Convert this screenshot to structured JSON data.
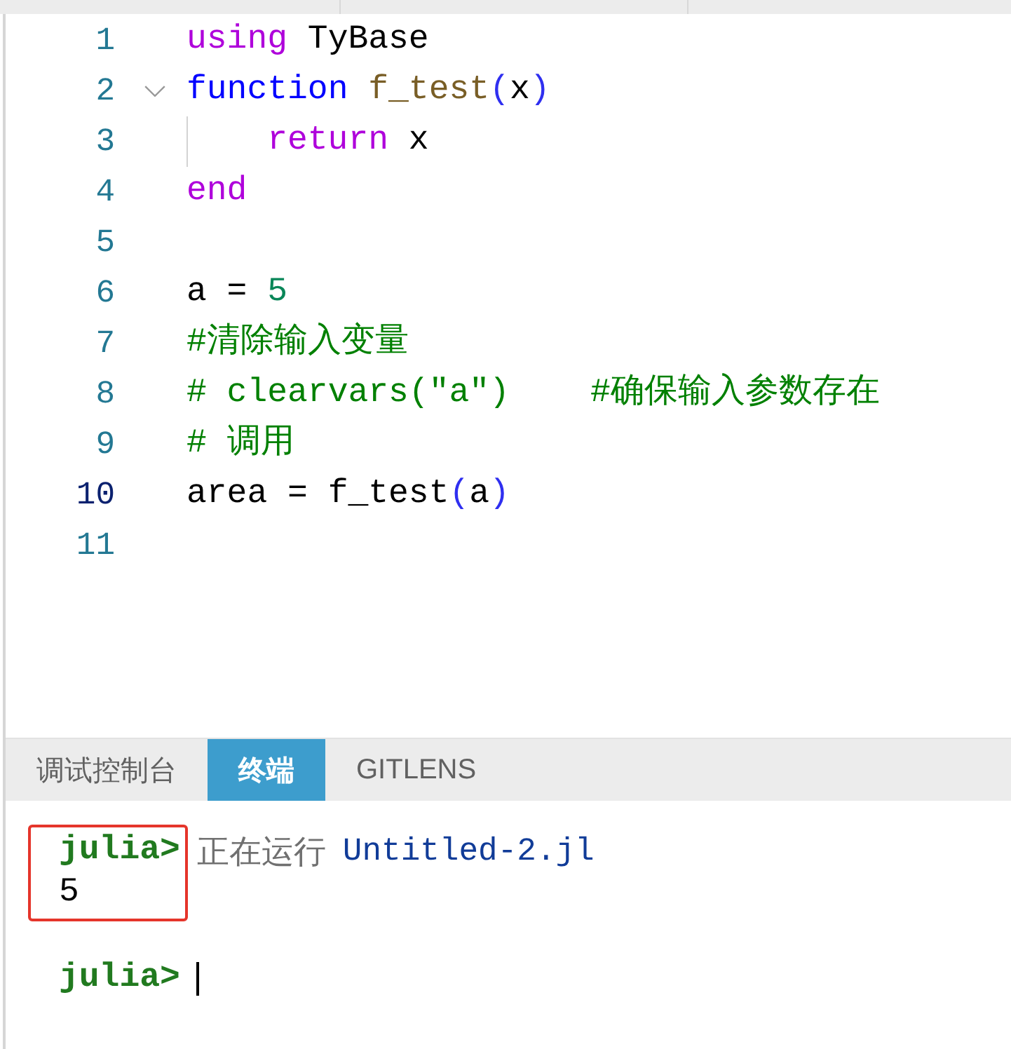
{
  "editor": {
    "lines": [
      {
        "number": "1",
        "active": false,
        "tokens": [
          {
            "kind": "keyword",
            "text": "using"
          },
          {
            "kind": "plain",
            "text": " TyBase"
          }
        ]
      },
      {
        "number": "2",
        "active": false,
        "expanded": true,
        "tokens": [
          {
            "kind": "storage",
            "text": "function"
          },
          {
            "kind": "funcname",
            "text": " f_test"
          },
          {
            "kind": "bracket",
            "text": "("
          },
          {
            "kind": "plain",
            "text": "x"
          },
          {
            "kind": "bracket",
            "text": ")"
          }
        ],
        "children": [
          {
            "number": "3",
            "active": false,
            "tokens": [
              {
                "kind": "keyword",
                "text": "return"
              },
              {
                "kind": "plain",
                "text": " x"
              }
            ]
          }
        ]
      },
      {
        "number": "4",
        "active": false,
        "tokens": [
          {
            "kind": "keyword",
            "text": "end"
          }
        ]
      },
      {
        "number": "5",
        "active": false
      },
      {
        "number": "6",
        "active": false,
        "tokens": [
          {
            "kind": "plain",
            "text": "a = "
          },
          {
            "kind": "number",
            "text": "5"
          }
        ]
      },
      {
        "number": "7",
        "active": false,
        "tokens": [
          {
            "kind": "comment",
            "text": "#清除输入变量"
          }
        ]
      },
      {
        "number": "8",
        "active": false,
        "tokens": [
          {
            "kind": "comment",
            "text": "# clearvars(\"a\")    #确保输入参数存在"
          }
        ]
      },
      {
        "number": "9",
        "active": false,
        "tokens": [
          {
            "kind": "comment",
            "text": "# 调用"
          }
        ]
      },
      {
        "number": "10",
        "active": true,
        "tokens": [
          {
            "kind": "plain",
            "text": "area = f_test"
          },
          {
            "kind": "bracket",
            "text": "("
          },
          {
            "kind": "plain",
            "text": "a"
          },
          {
            "kind": "bracket",
            "text": ")"
          }
        ]
      },
      {
        "number": "11",
        "active": false
      }
    ]
  },
  "panel": {
    "tabs": [
      {
        "label": "调试控制台",
        "selected": false
      },
      {
        "label": "终端",
        "selected": true
      },
      {
        "label": "GITLENS",
        "selected": false
      }
    ]
  },
  "terminal": {
    "blocks": [
      {
        "highlighted": true,
        "prompt": "julia>",
        "message": "正在运行",
        "file": "Untitled-2.jl",
        "output": "5",
        "cursor": false
      },
      {
        "highlighted": false,
        "prompt": "julia>",
        "cursor": true
      }
    ]
  }
}
